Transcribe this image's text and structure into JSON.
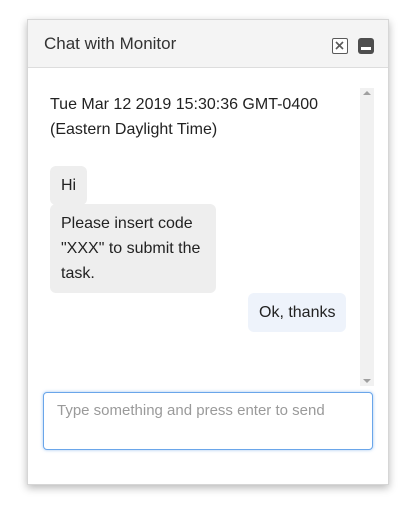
{
  "window": {
    "title": "Chat with Monitor",
    "close_icon": "close-square-icon",
    "minimize_icon": "minimize-icon"
  },
  "messages": {
    "timestamp": "Tue Mar 12 2019 15:30:36 GMT-0400 (Eastern Daylight Time)",
    "items": [
      {
        "sender": "monitor",
        "text": "Hi"
      },
      {
        "sender": "monitor",
        "text": "Please insert code \"XXX\" to submit the task."
      },
      {
        "sender": "user",
        "text": "Ok, thanks"
      }
    ]
  },
  "input": {
    "value": "",
    "placeholder": "Type something and press enter to send"
  },
  "colors": {
    "header_bg": "#f4f4f4",
    "incoming_bubble": "#eeeeee",
    "outgoing_bubble": "#eef3fb",
    "input_focus_border": "#6aa6ea"
  }
}
